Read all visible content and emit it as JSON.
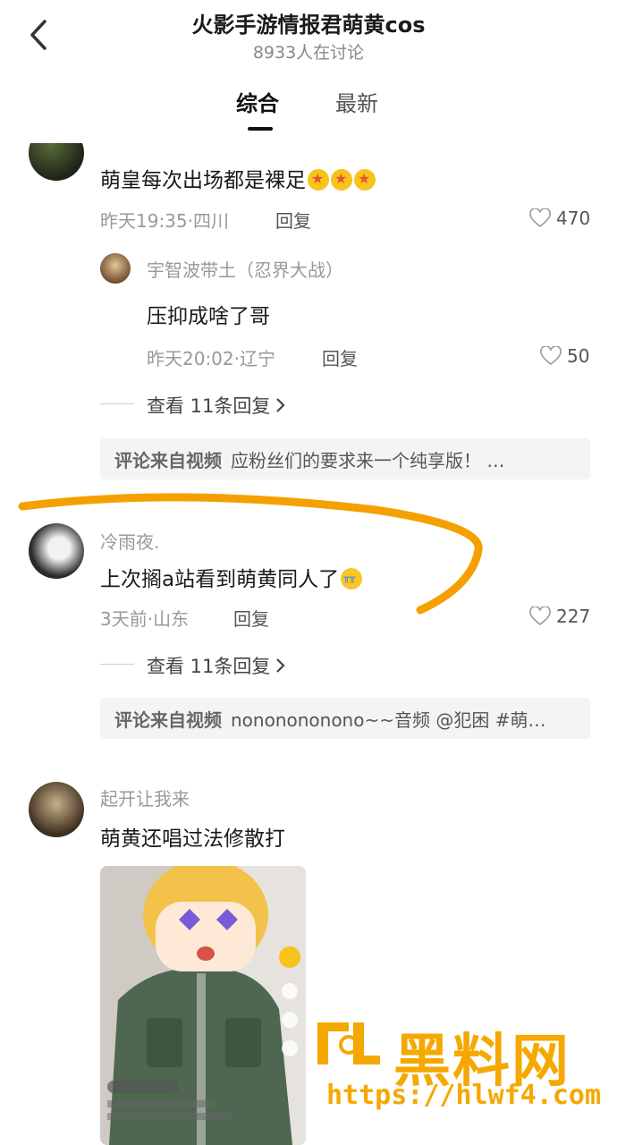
{
  "header": {
    "title": "火影手游情报君萌黄cos",
    "subtitle": "8933人在讨论"
  },
  "tabs": [
    {
      "label": "综合"
    },
    {
      "label": "最新"
    }
  ],
  "comments": [
    {
      "user": "",
      "text": "萌皇每次出场都是裸足",
      "meta": "昨天19:35·四川",
      "reply": "回复",
      "likes": "470",
      "sub_reply": {
        "user": "宇智波带土（忍界大战）",
        "text": "压抑成啥了哥",
        "meta": "昨天20:02·辽宁",
        "reply": "回复",
        "likes": "50"
      },
      "more_replies": "查看 11条回复",
      "source_label": "评论来自视频",
      "source_text": "应粉丝们的要求来一个纯享版！ …"
    },
    {
      "user": "冷雨夜.",
      "text": "上次搁a站看到萌黄同人了",
      "meta": "3天前·山东",
      "reply": "回复",
      "likes": "227",
      "more_replies": "查看 11条回复",
      "source_label": "评论来自视频",
      "source_text": "nononononono~~音频 @犯困 #萌…"
    },
    {
      "user": "起开让我来",
      "text": "萌黄还唱过法修散打"
    }
  ],
  "watermark": {
    "text": "黑料网",
    "url": "https://hlwf4.com"
  },
  "colors": {
    "annotation_orange": "#f5a000",
    "brand_orange": "#f5a800"
  }
}
